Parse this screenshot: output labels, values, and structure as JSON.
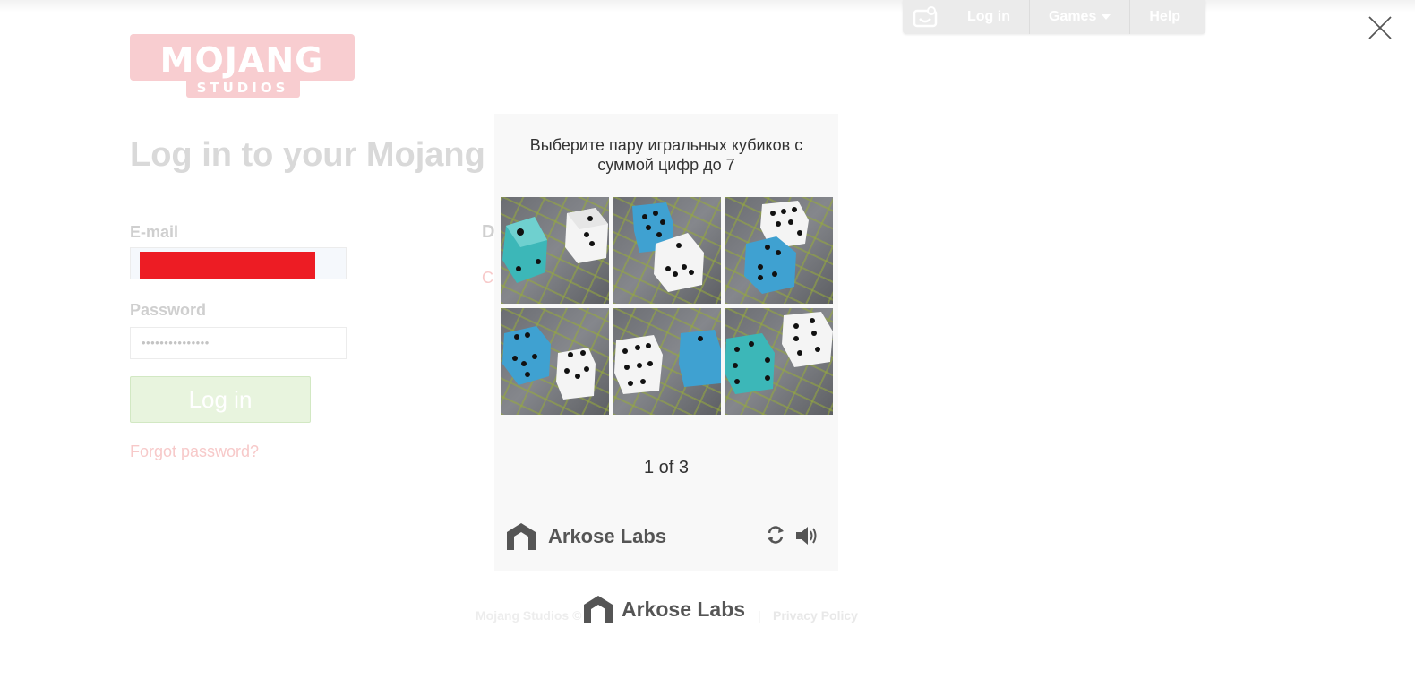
{
  "topnav": {
    "login_label": "Log in",
    "games_label": "Games",
    "help_label": "Help"
  },
  "brand": {
    "logo_word": "MOJANG",
    "logo_sub": "STUDIOS"
  },
  "page": {
    "title": "Log in to your Mojang Studios account",
    "email_label": "E-mail",
    "password_label": "Password",
    "password_mask": "•••••••••••••••",
    "login_button": "Log in",
    "forgot_link": "Forgot password?",
    "d_label": "D",
    "c_label": "C"
  },
  "footer": {
    "left_text": "Mojang Studios ©",
    "separator": "|",
    "privacy": "Privacy Policy"
  },
  "captcha": {
    "prompt": "Выберите пару игральных кубиков с суммой цифр до 7",
    "counter": "1 of 3",
    "brand": "Arkose Labs",
    "tiles": [
      {
        "index": 1
      },
      {
        "index": 2
      },
      {
        "index": 3
      },
      {
        "index": 4
      },
      {
        "index": 5
      },
      {
        "index": 6
      }
    ]
  },
  "bottom_brand": "Arkose Labs",
  "colors": {
    "redaction": "#ed1c24",
    "dice_blue": "#3fa1d1",
    "dice_teal": "#3cb7b8",
    "dice_white": "#f4f4f4"
  }
}
